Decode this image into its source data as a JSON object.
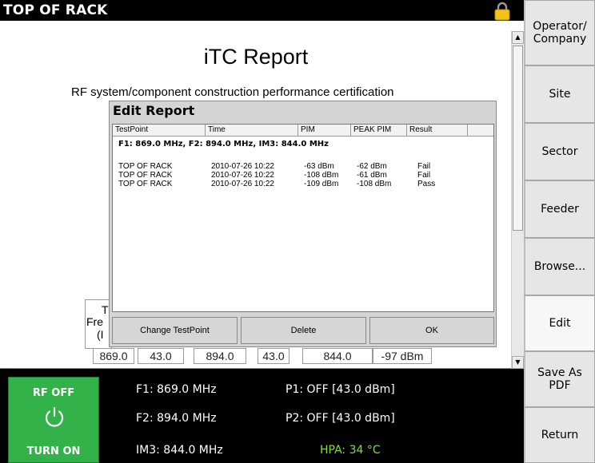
{
  "window": {
    "title": "TOP OF RACK"
  },
  "report": {
    "title": "iTC Report",
    "subtitle": "RF system/component construction performance certification"
  },
  "summary_fragments": {
    "line1": "T",
    "line2": "Fre",
    "line3": "(I"
  },
  "summary_values": [
    "869.0",
    "43.0",
    "894.0",
    "43.0",
    "844.0",
    "-97 dBm"
  ],
  "dialog": {
    "title": "Edit Report",
    "columns": [
      "TestPoint",
      "Time",
      "PIM",
      "PEAK PIM",
      "Result"
    ],
    "freq_line": "F1: 869.0 MHz, F2: 894.0 MHz, IM3: 844.0 MHz",
    "rows": [
      {
        "testpoint": "TOP OF RACK",
        "time": "2010-07-26 10:22",
        "pim": "-63 dBm",
        "peak": "-62 dBm",
        "result": "Fail"
      },
      {
        "testpoint": "TOP OF RACK",
        "time": "2010-07-26 10:22",
        "pim": "-108 dBm",
        "peak": "-61 dBm",
        "result": "Fail"
      },
      {
        "testpoint": "TOP OF RACK",
        "time": "2010-07-26 10:22",
        "pim": "-109 dBm",
        "peak": "-108 dBm",
        "result": "Pass"
      }
    ],
    "buttons": {
      "change": "Change TestPoint",
      "delete": "Delete",
      "ok": "OK"
    }
  },
  "softkeys": [
    "Operator/ Company",
    "Site",
    "Sector",
    "Feeder",
    "Browse...",
    "Edit",
    "Save As PDF",
    "Return"
  ],
  "status": {
    "rf_state": "RF OFF",
    "rf_action": "TURN ON",
    "f1": "F1: 869.0 MHz",
    "f2": "F2: 894.0 MHz",
    "im3": "IM3: 844.0 MHz",
    "p1": "P1: OFF [43.0 dBm]",
    "p2": "P2: OFF [43.0 dBm]",
    "hpa": "HPA: 34 °C"
  },
  "colors": {
    "rf_button": "#33b24a",
    "hpa_text": "#7fe043",
    "lock_icon": "#f2c21b"
  },
  "icons": [
    "lock-icon",
    "power-icon",
    "scroll-up-icon",
    "scroll-down-icon"
  ]
}
